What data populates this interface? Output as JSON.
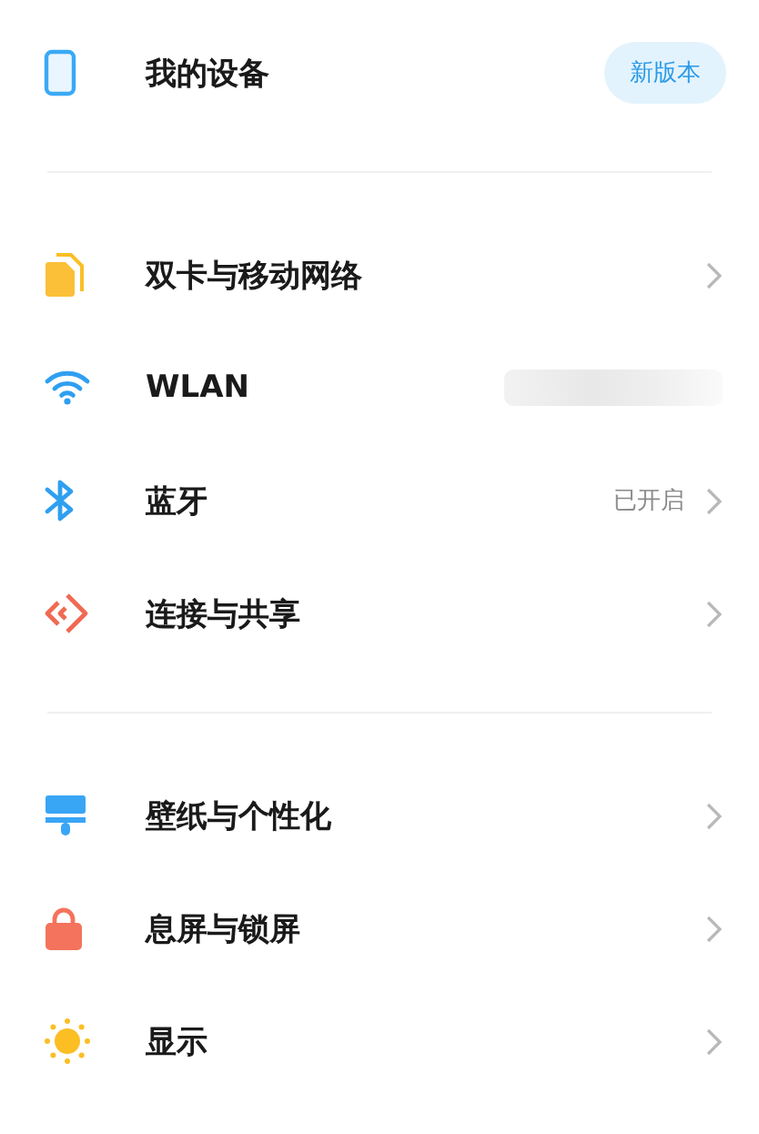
{
  "sections": [
    {
      "items": [
        {
          "label": "我的设备",
          "kind": "badge",
          "badge": "新版本"
        }
      ]
    },
    {
      "items": [
        {
          "label": "双卡与移动网络",
          "kind": "chevron"
        },
        {
          "label": "WLAN",
          "kind": "redacted"
        },
        {
          "label": "蓝牙",
          "kind": "status",
          "status": "已开启"
        },
        {
          "label": "连接与共享",
          "kind": "chevron"
        }
      ]
    },
    {
      "items": [
        {
          "label": "壁纸与个性化",
          "kind": "chevron"
        },
        {
          "label": "息屏与锁屏",
          "kind": "chevron"
        },
        {
          "label": "显示",
          "kind": "chevron"
        }
      ]
    }
  ]
}
